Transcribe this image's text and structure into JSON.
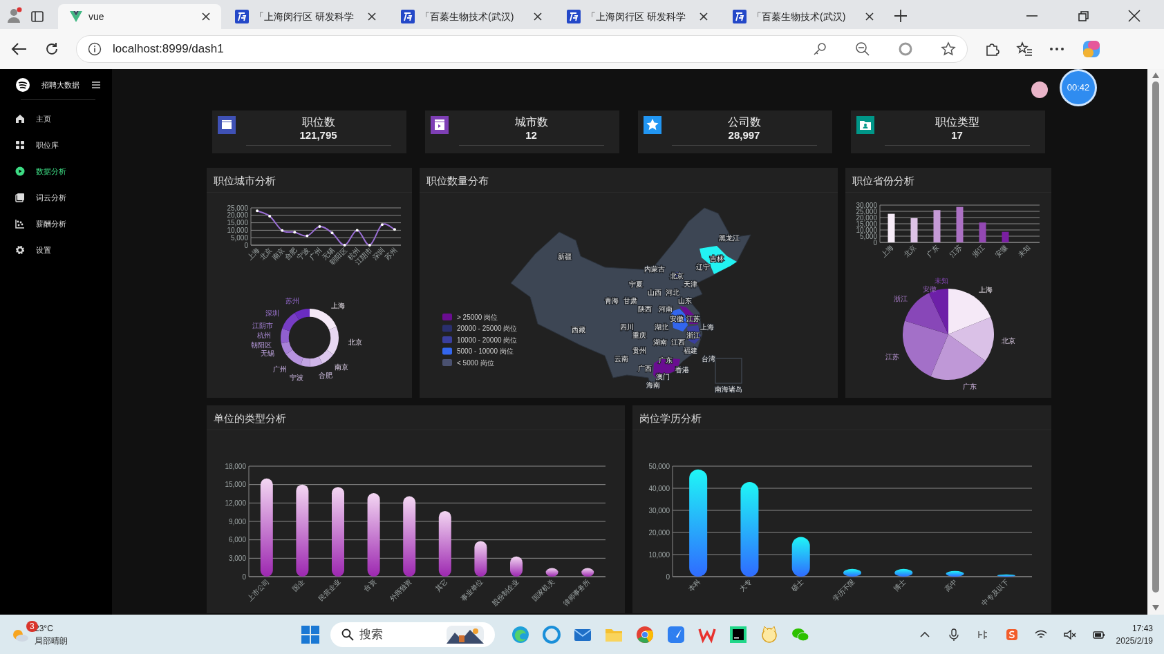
{
  "browser": {
    "tabs": [
      {
        "title": "vue",
        "selected": true,
        "kind": "vue"
      },
      {
        "title": "「上海闵行区 研发科学",
        "selected": false,
        "kind": "site"
      },
      {
        "title": "「百蓁生物技术(武汉)",
        "selected": false,
        "kind": "site"
      },
      {
        "title": "「上海闵行区 研发科学",
        "selected": false,
        "kind": "site"
      },
      {
        "title": "「百蓁生物技术(武汉)",
        "selected": false,
        "kind": "site"
      }
    ],
    "address": "localhost:8999/dash1"
  },
  "sidebar": {
    "brand": "招聘大数据",
    "items": [
      {
        "label": "主页",
        "kind": "home",
        "selected": false
      },
      {
        "label": "职位库",
        "kind": "grid",
        "selected": false
      },
      {
        "label": "数据分析",
        "kind": "play",
        "selected": true
      },
      {
        "label": "词云分析",
        "kind": "cloud",
        "selected": false
      },
      {
        "label": "薪酬分析",
        "kind": "scatter",
        "selected": false
      },
      {
        "label": "设置",
        "kind": "gear",
        "selected": false
      }
    ]
  },
  "timer": "00:42",
  "stats": [
    {
      "label": "职位数",
      "value": "121,795",
      "kind": "clapper",
      "color": "#3f51b5"
    },
    {
      "label": "城市数",
      "value": "12",
      "kind": "inbox",
      "color": "#7e3fb5"
    },
    {
      "label": "公司数",
      "value": "28,997",
      "kind": "star",
      "color": "#2196f3"
    },
    {
      "label": "职位类型",
      "value": "17",
      "kind": "folder",
      "color": "#009688"
    }
  ],
  "city_panel": {
    "title": "职位城市分析",
    "line_chart": {
      "chart_data": {
        "type": "line",
        "grid": true,
        "categories": [
          "上海",
          "北京",
          "南京",
          "合肥",
          "宁波",
          "广州",
          "无锡",
          "朝阳区",
          "杭州",
          "江阴市",
          "深圳",
          "苏州"
        ],
        "series": [
          {
            "color": "#9b6fd6",
            "values": [
              23000,
              19500,
              9800,
              8700,
              6200,
              12500,
              8200,
              0,
              10000,
              0,
              13800,
              10500
            ]
          }
        ],
        "ylim": [
          0,
          25000
        ],
        "yticks": [
          {
            "value": 0,
            "label": "0"
          },
          {
            "value": 5000,
            "label": "5,000"
          },
          {
            "value": 10000,
            "label": "10,000"
          },
          {
            "value": 15000,
            "label": "15,000"
          },
          {
            "value": 20000,
            "label": "20,000"
          },
          {
            "value": 25000,
            "label": "25,000"
          }
        ]
      }
    },
    "donut_chart": {
      "chart_data": {
        "type": "donut",
        "categories": [
          "上海",
          "北京",
          "南京",
          "合肥",
          "宁波",
          "广州",
          "无锡",
          "朝阳区",
          "杭州",
          "江阴市",
          "深圳",
          "苏州"
        ],
        "values": [
          18.8,
          16.0,
          8.0,
          7.1,
          5.1,
          10.2,
          6.7,
          0,
          8.2,
          0,
          11.3,
          8.6
        ]
      }
    }
  },
  "map_panel": {
    "title": "职位数量分布",
    "regions": [
      {
        "name": "新疆"
      },
      {
        "name": "西藏"
      },
      {
        "name": "青海"
      },
      {
        "name": "甘肃"
      },
      {
        "name": "宁夏"
      },
      {
        "name": "内蒙古"
      },
      {
        "name": "陕西"
      },
      {
        "name": "山西"
      },
      {
        "name": "河北"
      },
      {
        "name": "北京",
        "color": "#3a3f9e"
      },
      {
        "name": "天津"
      },
      {
        "name": "山东"
      },
      {
        "name": "河南"
      },
      {
        "name": "辽宁"
      },
      {
        "name": "吉林",
        "color": "#22f2f2"
      },
      {
        "name": "黑龙江"
      },
      {
        "name": "四川"
      },
      {
        "name": "重庆"
      },
      {
        "name": "湖北"
      },
      {
        "name": "安徽",
        "color": "#3366ee"
      },
      {
        "name": "江苏",
        "color": "#6a0d91"
      },
      {
        "name": "上海"
      },
      {
        "name": "浙江",
        "color": "#3a3f9e"
      },
      {
        "name": "湖南"
      },
      {
        "name": "江西"
      },
      {
        "name": "贵州"
      },
      {
        "name": "云南"
      },
      {
        "name": "广西"
      },
      {
        "name": "广东",
        "color": "#6a0d91"
      },
      {
        "name": "福建"
      },
      {
        "name": "台湾"
      },
      {
        "name": "香港"
      },
      {
        "name": "澳门"
      },
      {
        "name": "海南"
      },
      {
        "name": "南海诸岛"
      }
    ],
    "legend": [
      {
        "label": "> 25000 岗位",
        "color": "#6a0d91"
      },
      {
        "label": "20000 - 25000 岗位",
        "color": "#2a2f6e"
      },
      {
        "label": "10000 - 20000 岗位",
        "color": "#3a3f9e"
      },
      {
        "label": "5000 - 10000 岗位",
        "color": "#3366ee"
      },
      {
        "label": "< 5000 岗位",
        "color": "#4a5170"
      }
    ]
  },
  "province_panel": {
    "title": "职位省份分析",
    "bar_chart": {
      "chart_data": {
        "type": "bar",
        "grid": true,
        "categories": [
          "上海",
          "北京",
          "广东",
          "江苏",
          "浙江",
          "安徽",
          "未知"
        ],
        "series": [
          {
            "values": [
              23000,
              19500,
              26000,
              28500,
              16000,
              8500,
              0
            ]
          }
        ],
        "ylim": [
          0,
          30000
        ],
        "yticks": [
          {
            "value": 0,
            "label": "0"
          },
          {
            "value": 5000,
            "label": "5,000"
          },
          {
            "value": 10000,
            "label": "10,000"
          },
          {
            "value": 15000,
            "label": "15,000"
          },
          {
            "value": 20000,
            "label": "20,000"
          },
          {
            "value": 25000,
            "label": "25,000"
          },
          {
            "value": 30000,
            "label": "30,000"
          }
        ]
      }
    },
    "pie_chart": {
      "chart_data": {
        "type": "pie",
        "categories": [
          "上海",
          "北京",
          "广东",
          "江苏",
          "浙江",
          "安徽",
          "未知"
        ],
        "values": [
          18.9,
          16.0,
          21.4,
          23.5,
          13.2,
          7.0,
          0
        ]
      }
    }
  },
  "company_panel": {
    "title": "单位的类型分析",
    "chart_data": {
      "type": "bar",
      "grid": true,
      "categories": [
        "上市公司",
        "国企",
        "民营企业",
        "合资",
        "外商独资",
        "其它",
        "事业单位",
        "股份制企业",
        "国家机关",
        "律师事务所"
      ],
      "series": [
        {
          "color": "#9c27b0",
          "values": [
            16000,
            15000,
            14600,
            13600,
            13100,
            10700,
            5800,
            3300,
            1400,
            1400
          ]
        }
      ],
      "ylim": [
        0,
        18000
      ],
      "yticks": [
        {
          "value": 0,
          "label": "0"
        },
        {
          "value": 3000,
          "label": "3,000"
        },
        {
          "value": 6000,
          "label": "6,000"
        },
        {
          "value": 9000,
          "label": "9,000"
        },
        {
          "value": 12000,
          "label": "12,000"
        },
        {
          "value": 15000,
          "label": "15,000"
        },
        {
          "value": 18000,
          "label": "18,000"
        }
      ]
    }
  },
  "education_panel": {
    "title": "岗位学历分析",
    "chart_data": {
      "type": "bar",
      "grid": true,
      "categories": [
        "本科",
        "大专",
        "硕士",
        "学历不限",
        "博士",
        "高中",
        "中专及以下"
      ],
      "series": [
        {
          "color": "#2f6bff",
          "values": [
            48500,
            42800,
            18000,
            3500,
            3500,
            2600,
            1000
          ]
        }
      ],
      "ylim": [
        0,
        50000
      ],
      "yticks": [
        {
          "value": 0,
          "label": "0"
        },
        {
          "value": 10000,
          "label": "10,000"
        },
        {
          "value": 20000,
          "label": "20,000"
        },
        {
          "value": 30000,
          "label": "30,000"
        },
        {
          "value": 40000,
          "label": "40,000"
        },
        {
          "value": 50000,
          "label": "50,000"
        }
      ]
    }
  },
  "taskbar": {
    "weather_badge": "3",
    "temperature": "23°C",
    "weather": "局部晴朗",
    "search_placeholder": "搜索",
    "time": "17:43",
    "date": "2025/2/19"
  }
}
